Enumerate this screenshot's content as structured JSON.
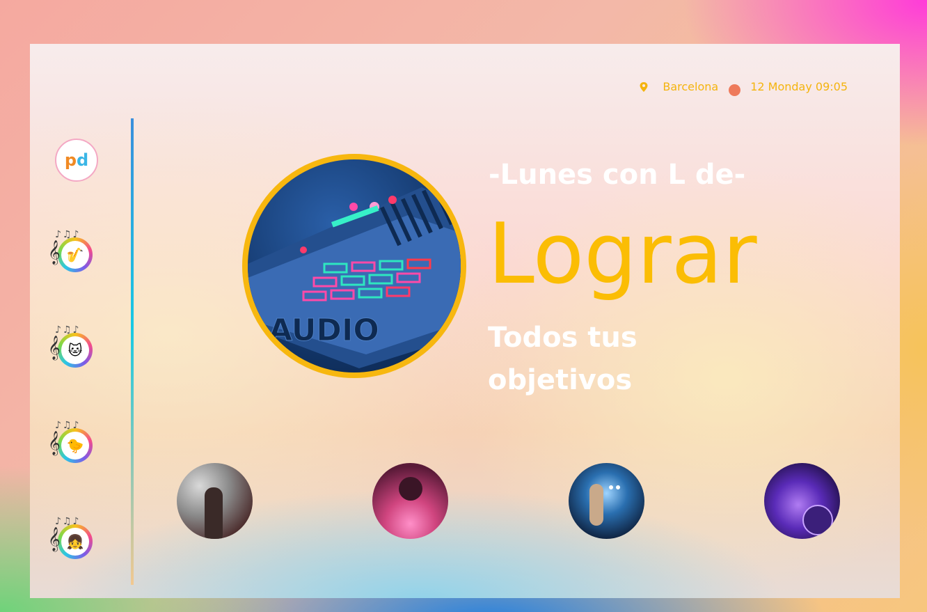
{
  "header": {
    "location": "Barcelona",
    "datetime": "12 Monday 09:05",
    "location_icon": "location-pin-icon",
    "status_color": "#ee7a5b"
  },
  "sidebar": {
    "logo_text_p": "p",
    "logo_text_d": "d",
    "items": [
      {
        "icon": "music-instruments-icon"
      },
      {
        "icon": "music-cat-icon"
      },
      {
        "icon": "music-duck-icon"
      },
      {
        "icon": "music-kid-add-icon"
      }
    ]
  },
  "hero": {
    "tagline": "-Lunes con L de-",
    "word": "Lograr",
    "subline": "Todos tus objetivos",
    "image_label": "AUDIO",
    "accent": "#fbbd04"
  },
  "thumbnails": [
    {
      "name": "concert-crowd-thumb"
    },
    {
      "name": "pink-smoke-thumb"
    },
    {
      "name": "stage-lights-thumb"
    },
    {
      "name": "dj-deck-thumb"
    }
  ]
}
